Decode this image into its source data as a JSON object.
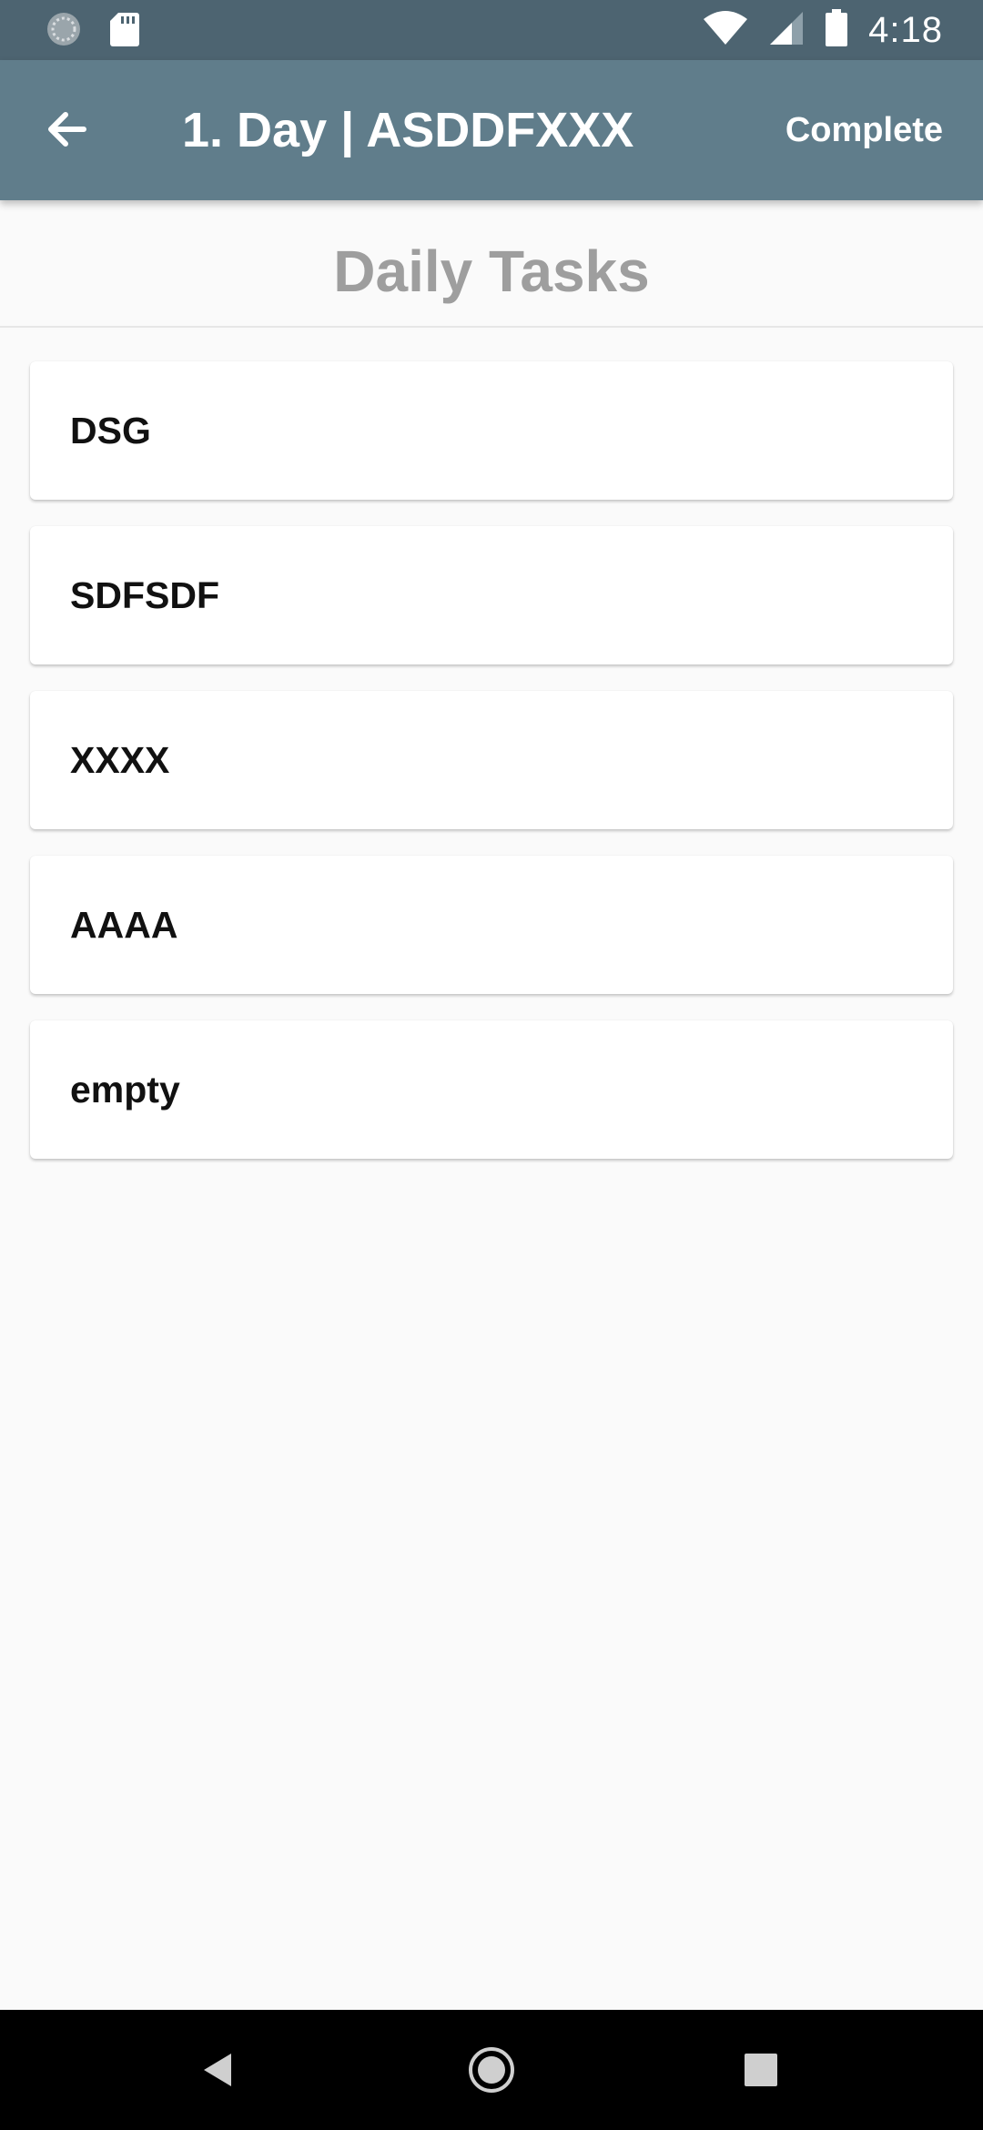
{
  "status_bar": {
    "time": "4:18",
    "icons": [
      "sync-icon",
      "sd-card-icon",
      "wifi-icon",
      "signal-icon",
      "battery-icon"
    ]
  },
  "app_bar": {
    "title": "1. Day | ASDDFXXX",
    "action_label": "Complete",
    "background": "#607d8b"
  },
  "section": {
    "title": "Daily Tasks"
  },
  "tasks": [
    {
      "label": "DSG"
    },
    {
      "label": "SDFSDF"
    },
    {
      "label": "XXXX"
    },
    {
      "label": "AAAA"
    },
    {
      "label": "empty"
    }
  ],
  "nav_bar": {
    "buttons": [
      "back-icon",
      "home-icon",
      "recents-icon"
    ]
  }
}
